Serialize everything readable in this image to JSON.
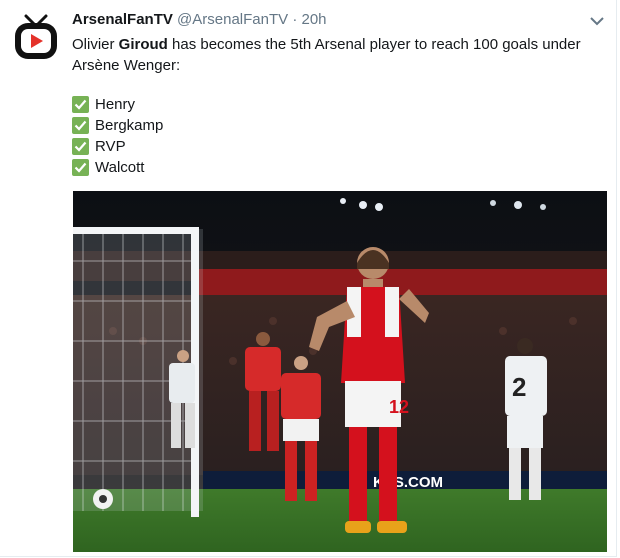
{
  "tweet": {
    "display_name": "ArsenalFanTV",
    "handle": "@ArsenalFanTV",
    "separator": "·",
    "time": "20h",
    "text_before": "Olivier ",
    "text_bold": "Giroud",
    "text_after": " has becomes the 5th Arsenal player to reach 100 goals under Arsène Wenger:",
    "list": [
      "Henry",
      "Bergkamp",
      "RVP",
      "Walcott"
    ],
    "image_banner": "KES.COM"
  },
  "colors": {
    "check": "#77b255",
    "avatar_red": "#e4322a",
    "arsenal_red": "#d4111d"
  },
  "icons": {
    "avatar": "tv-icon",
    "menu": "chevron-down-icon",
    "check": "check-mark-icon"
  }
}
